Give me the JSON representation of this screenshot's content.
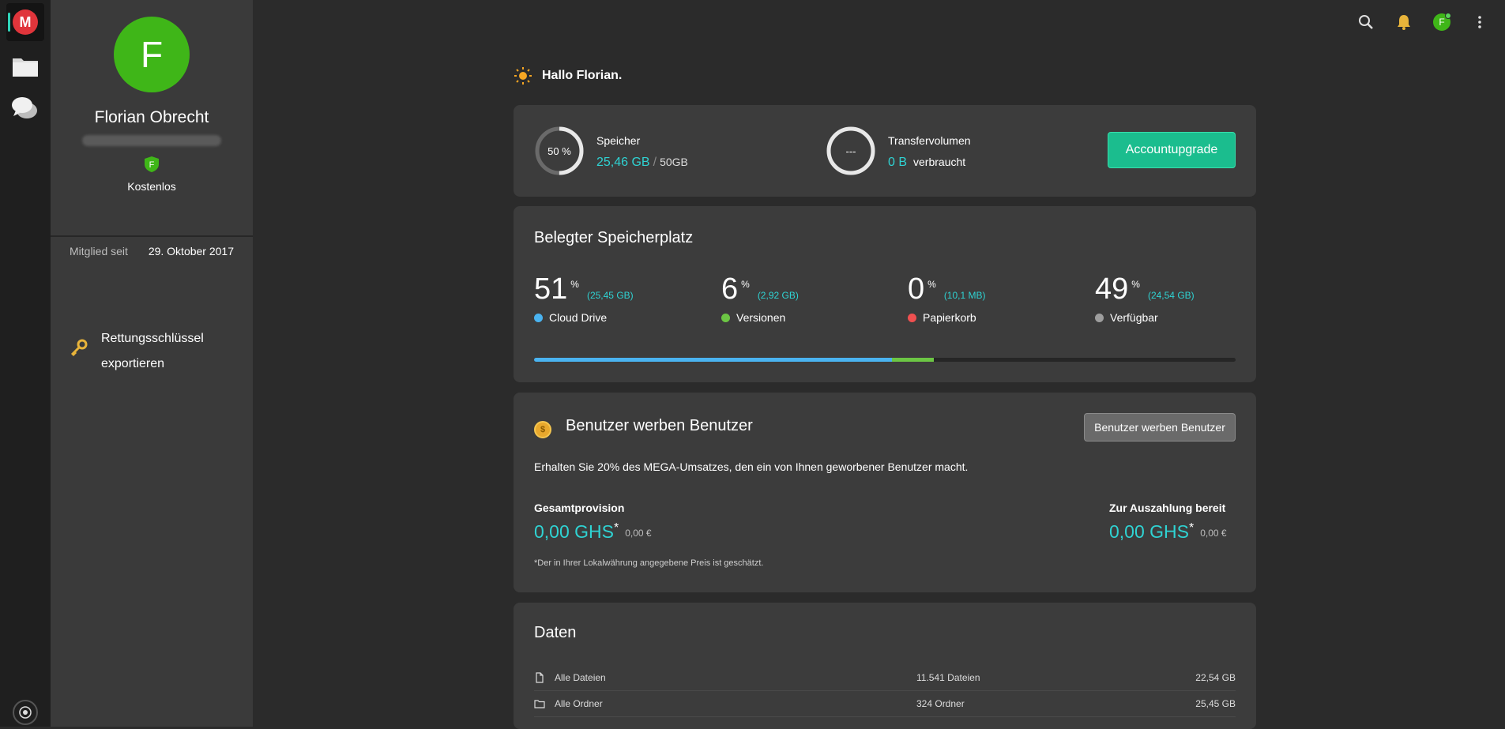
{
  "sidebar": {
    "avatar_letter": "F",
    "name": "Florian Obrecht",
    "plan": "Kostenlos",
    "plan_badge_letter": "F",
    "member_since_label": "Mitglied seit",
    "member_since_value": "29. Oktober 2017",
    "recovery_line1": "Rettungsschlüssel",
    "recovery_line2": "exportieren"
  },
  "topbar": {
    "avatar_letter": "F"
  },
  "greeting": "Hallo Florian.",
  "quota": {
    "storage_label": "Speicher",
    "storage_percent_text": "50 %",
    "storage_percent": 50,
    "storage_used": "25,46 GB",
    "storage_sep": "/",
    "storage_total": "50GB",
    "transfer_label": "Transfervolumen",
    "transfer_ring_text": "---",
    "transfer_used": "0 B",
    "transfer_used_suffix": "verbraucht",
    "upgrade_label": "Accountupgrade"
  },
  "usage": {
    "title": "Belegter Speicherplatz",
    "percent_sign": "%",
    "items": [
      {
        "value": "51",
        "size": "(25,45 GB)",
        "label": "Cloud Drive",
        "color": "#4ab3f0",
        "fraction": 0.51
      },
      {
        "value": "6",
        "size": "(2,92 GB)",
        "label": "Versionen",
        "color": "#6cc644",
        "fraction": 0.06
      },
      {
        "value": "0",
        "size": "(10,1 MB)",
        "label": "Papierkorb",
        "color": "#f05050",
        "fraction": 0.0
      },
      {
        "value": "49",
        "size": "(24,54 GB)",
        "label": "Verfügbar",
        "color": "#9e9e9e",
        "fraction": 0.49
      }
    ]
  },
  "referral": {
    "coin_symbol": "$",
    "title": "Benutzer werben Benutzer",
    "button_label": "Benutzer werben Benutzer",
    "description": "Erhalten Sie 20% des MEGA-Umsatzes, den ein von Ihnen geworbener Benutzer macht.",
    "total_label": "Gesamtprovision",
    "total_value": "0,00 GHS",
    "total_eur": "0,00 €",
    "payout_label": "Zur Auszahlung bereit",
    "payout_value": "0,00 GHS",
    "payout_eur": "0,00 €",
    "asterisk": "*",
    "footnote": "*Der in Ihrer Lokalwährung angegebene Preis ist geschätzt."
  },
  "data": {
    "title": "Daten",
    "rows": [
      {
        "label": "Alle Dateien",
        "count": "11.541 Dateien",
        "size": "22,54 GB",
        "icon": "file-icon"
      },
      {
        "label": "Alle Ordner",
        "count": "324 Ordner",
        "size": "25,45 GB",
        "icon": "folder-icon"
      }
    ]
  },
  "colors": {
    "accent": "#2fd3d3",
    "upgrade": "#1bbd8e",
    "avatar": "#3fb618"
  }
}
